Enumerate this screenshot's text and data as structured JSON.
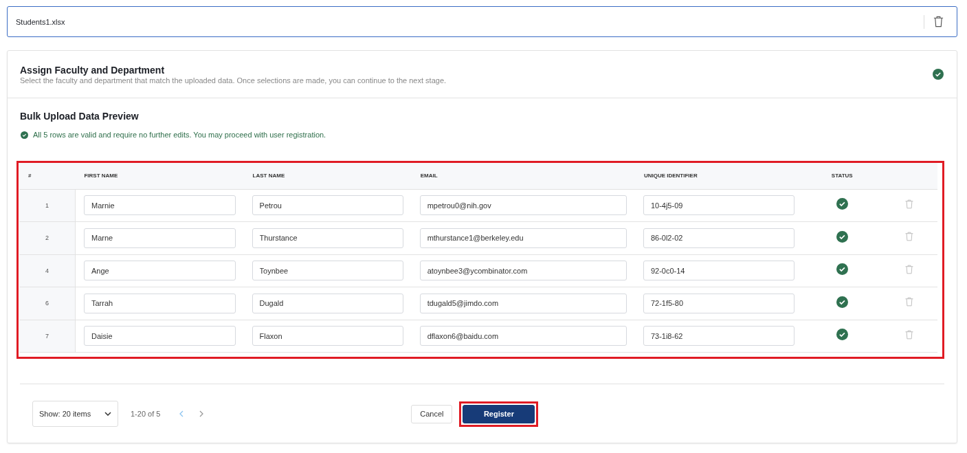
{
  "file": {
    "name": "Students1.xlsx"
  },
  "assign_section": {
    "title": "Assign Faculty and Department",
    "description": "Select the faculty and department that match the uploaded data. Once selections are made, you can continue to the next stage.",
    "complete": true
  },
  "preview": {
    "title": "Bulk Upload Data Preview",
    "message": "All 5 rows are valid and require no further edits. You may proceed with user registration.",
    "highlighted": true
  },
  "table": {
    "columns": [
      "#",
      "FIRST NAME",
      "LAST NAME",
      "EMAIL",
      "UNIQUE IDENTIFIER",
      "STATUS"
    ],
    "rows": [
      {
        "number": "1",
        "first_name": "Marnie",
        "last_name": "Petrou",
        "email": "mpetrou0@nih.gov",
        "unique_identifier": "10-4j5-09",
        "valid": true
      },
      {
        "number": "2",
        "first_name": "Marne",
        "last_name": "Thurstance",
        "email": "mthurstance1@berkeley.edu",
        "unique_identifier": "86-0l2-02",
        "valid": true
      },
      {
        "number": "4",
        "first_name": "Ange",
        "last_name": "Toynbee",
        "email": "atoynbee3@ycombinator.com",
        "unique_identifier": "92-0c0-14",
        "valid": true
      },
      {
        "number": "6",
        "first_name": "Tarrah",
        "last_name": "Dugald",
        "email": "tdugald5@jimdo.com",
        "unique_identifier": "72-1f5-80",
        "valid": true
      },
      {
        "number": "7",
        "first_name": "Daisie",
        "last_name": "Flaxon",
        "email": "dflaxon6@baidu.com",
        "unique_identifier": "73-1i8-62",
        "valid": true
      }
    ]
  },
  "pagination": {
    "page_size": "Show: 20 items",
    "range": "1-20 of 5"
  },
  "buttons": [
    {
      "label": "Cancel",
      "kind": "secondary",
      "highlighted": false
    },
    {
      "label": "Register",
      "kind": "primary",
      "highlighted": true
    }
  ]
}
